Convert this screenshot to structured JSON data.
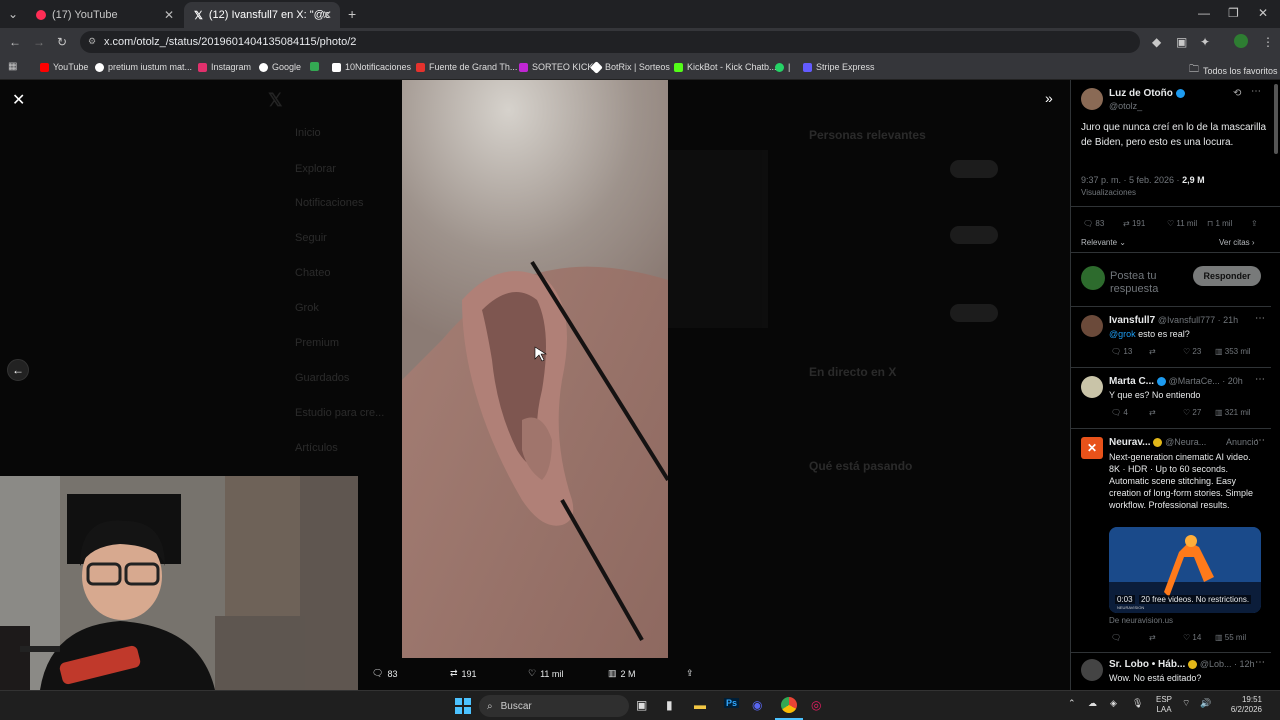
{
  "browser": {
    "tabs": [
      {
        "label": "(17) YouTube",
        "close": "✕"
      },
      {
        "label": "(12) Ivansfull7 en X: \"@otolz_@",
        "close": "✕"
      }
    ],
    "new_tab": "+",
    "url": "x.com/otolz_/status/2019601404135084115/photo/2",
    "bookmarks": [
      {
        "label": "YouTube",
        "color": "#ff0000"
      },
      {
        "label": "pretium iustum mat...",
        "color": "#ffffff"
      },
      {
        "label": "Instagram",
        "color": "#e1306c"
      },
      {
        "label": "Google",
        "color": "#ffffff"
      },
      {
        "label": "",
        "color": "#34a853"
      },
      {
        "label": "10Notificaciones",
        "color": "#ffffff"
      },
      {
        "label": "Fuente de Grand Th...",
        "color": "#e5322d"
      },
      {
        "label": "SORTEO KICK",
        "color": "#c026d3"
      },
      {
        "label": "BotRix | Sorteos",
        "color": "#ffffff"
      },
      {
        "label": "KickBot - Kick Chatb...",
        "color": "#53fc18"
      },
      {
        "label": "|",
        "color": "#25d366"
      },
      {
        "label": "Stripe Express",
        "color": "#635bff"
      }
    ],
    "all_bookmarks": "Todos los favoritos"
  },
  "media": {
    "stats": {
      "replies": "83",
      "reposts": "191",
      "likes": "11 mil",
      "views": "2 M"
    },
    "ghost_nav": [
      "Inicio",
      "Explorar",
      "Notificaciones",
      "Seguir",
      "Chateo",
      "Grok",
      "Premium",
      "Guardados",
      "Estudio para cre...",
      "Artículos"
    ],
    "ghost_right": [
      "Personas relevantes",
      "En directo en X",
      "Qué está pasando"
    ]
  },
  "post": {
    "author": "Luz de Otoño",
    "handle": "@otolz_",
    "text": "Juro que nunca creí en lo de la mascarilla de Biden, pero esto es una locura.",
    "time": "9:37 p. m. · 5 feb. 2026 ·",
    "views_count": "2,9 M",
    "views_label": "Visualizaciones",
    "actions": {
      "replies": "83",
      "reposts": "191",
      "likes": "11 mil",
      "bookmarks": "1 mil"
    },
    "sort_label": "Relevante",
    "quotes_label": "Ver citas",
    "reply_placeholder": "Postea tu respuesta",
    "reply_button": "Responder"
  },
  "replies": [
    {
      "name": "Ivansfull7",
      "handle": "@Ivansfull777 · 21h",
      "mention": "@grok",
      "text": "esto es real?",
      "replies": "13",
      "reposts": "",
      "likes": "23",
      "views": "353 mil"
    },
    {
      "name": "Marta C...",
      "handle": "@MartaCe... · 20h",
      "text": "Y que es? No entiendo",
      "replies": "4",
      "reposts": "",
      "likes": "27",
      "views": "321 mil"
    },
    {
      "name": "Neurav...",
      "handle": "@Neura...",
      "ad": "Anuncio",
      "text": "Next-generation cinematic AI video. 8K · HDR · Up to 60 seconds. Automatic scene stitching. Easy creation of long-form stories. Simple workflow. Professional results.",
      "video_time": "0:03",
      "video_caption": "20 free videos. No restrictions.",
      "video_brand": "NEURAVISION",
      "source": "De neuravision.us",
      "likes": "14",
      "views": "55 mil"
    },
    {
      "name": "Sr. Lobo • Háb...",
      "handle": "@Lob... · 12h",
      "text": "Wow. No está editado?"
    }
  ],
  "taskbar": {
    "search": "Buscar",
    "lang": "ESP",
    "region": "LAA",
    "time": "19:51",
    "date": "6/2/2026"
  },
  "colors": {
    "accent": "#1d9bf0",
    "reply_button": "#787a7a",
    "background": "#000000"
  }
}
